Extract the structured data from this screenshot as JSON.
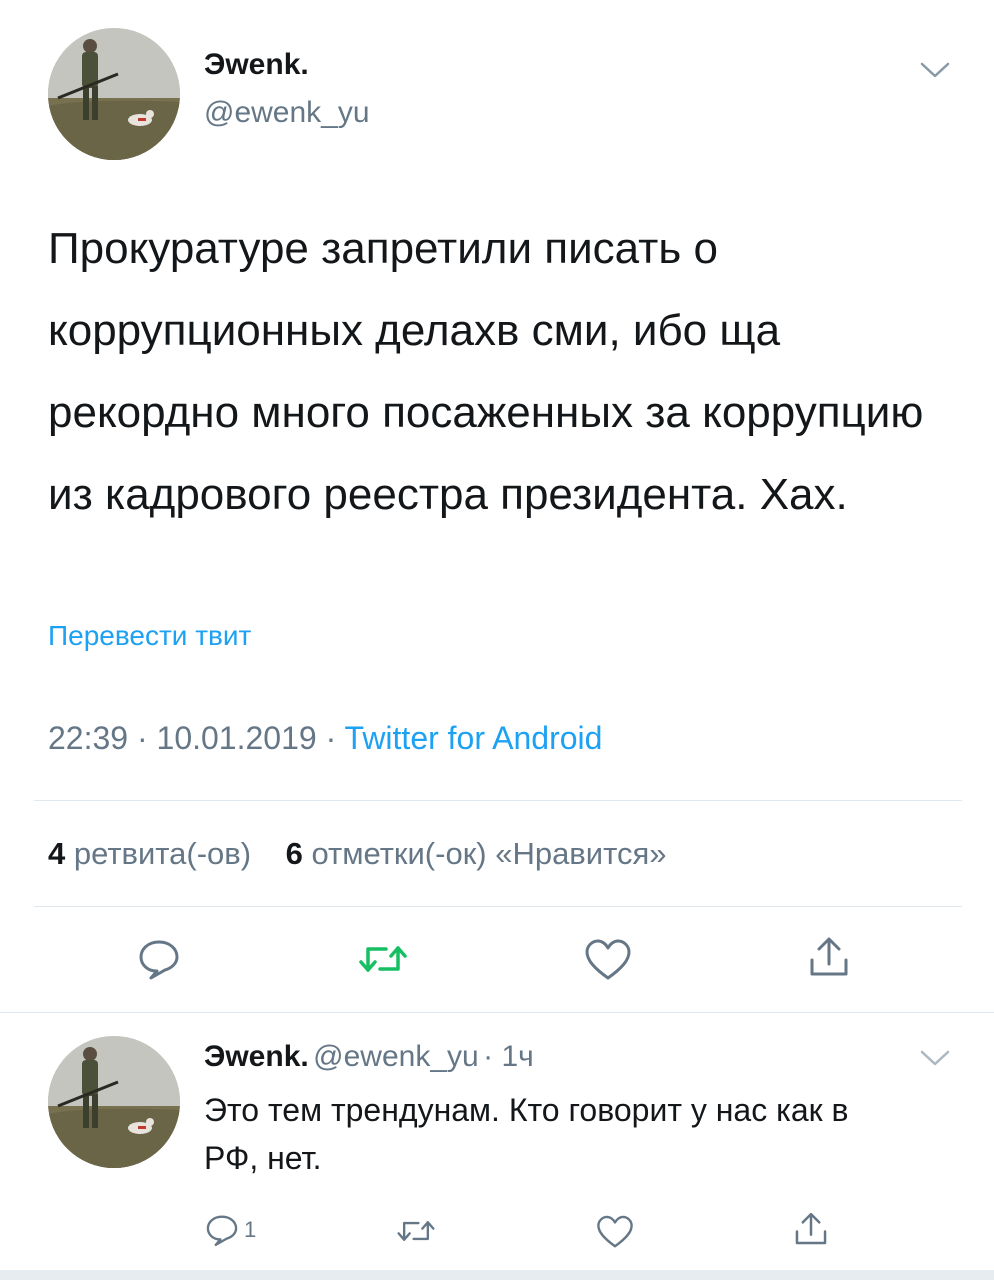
{
  "tweet": {
    "author_name": "Эwenk.",
    "author_handle": "@ewenk_yu",
    "text": "Прокуратуре запретили писать о коррупционных делахв сми, ибо ща рекордно много посаженных за коррупцию из кадрового реестра президента. Хах.",
    "translate_label": "Перевести твит",
    "time": "22:39",
    "date": "10.01.2019",
    "source": "Twitter for Android",
    "retweet_count": "4",
    "retweet_label": "ретвита(-ов)",
    "like_count": "6",
    "like_label": "отметки(-ок) «Нравится»"
  },
  "reply": {
    "author_name": "Эwenk.",
    "author_handle": "@ewenk_yu",
    "age": "1ч",
    "text": "Это тем трендунам. Кто говорит у нас как в РФ, нет.",
    "reply_count": "1"
  },
  "colors": {
    "accent": "#1da1f2",
    "retweet_green": "#17bf63",
    "secondary_text": "#657786",
    "divider": "#e1e8ed"
  },
  "icons": {
    "reply": "speech-bubble-icon",
    "retweet": "retweet-arrows-icon",
    "like": "heart-icon",
    "share": "share-upload-icon",
    "menu": "chevron-down-icon"
  }
}
